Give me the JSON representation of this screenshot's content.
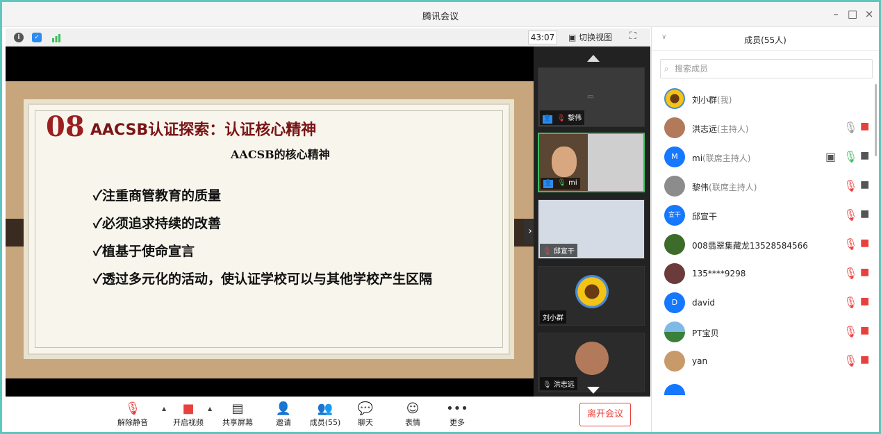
{
  "window": {
    "title": "腾讯会议"
  },
  "infobar": {
    "timer": "43:07",
    "switch_view": "切换视图"
  },
  "slide": {
    "number": "08",
    "title": "AACSB认证探索：认证核心精神",
    "subtitle": "AACSB的核心精神",
    "bullets": [
      "✓注重商管教育的质量",
      "✓必须追求持续的改善",
      "✓植基于使命宣言",
      "✓透过多元化的活动，使认证学校可以与其他学校产生区隔"
    ]
  },
  "thumbnails": [
    {
      "name": "黎伟"
    },
    {
      "name": "mi"
    },
    {
      "name": "邱宣干"
    },
    {
      "name": "刘小群"
    },
    {
      "name": "洪志远"
    }
  ],
  "toolbar": {
    "unmute": "解除静音",
    "start_video": "开启视频",
    "share_screen": "共享屏幕",
    "invite": "邀请",
    "members": "成员(55)",
    "chat": "聊天",
    "reactions": "表情",
    "more": "更多",
    "leave": "离开会议"
  },
  "members": {
    "title": "成员(55人)",
    "search_placeholder": "搜索成员",
    "list": [
      {
        "name": "刘小群",
        "role": "(我)"
      },
      {
        "name": "洪志远",
        "role": "(主持人)"
      },
      {
        "name": "mi",
        "role": "(联席主持人)",
        "avatar_text": "M"
      },
      {
        "name": "黎伟",
        "role": "(联席主持人)"
      },
      {
        "name": "邱宣干",
        "role": "",
        "avatar_text": "宣干"
      },
      {
        "name": "008翡翠集藏龙13528584566",
        "role": ""
      },
      {
        "name": "135****9298",
        "role": ""
      },
      {
        "name": "david",
        "role": "",
        "avatar_text": "D"
      },
      {
        "name": "PT宝贝",
        "role": ""
      },
      {
        "name": "yan",
        "role": ""
      }
    ]
  },
  "colors": {
    "accent": "#2d8cf0",
    "danger": "#e8413d",
    "active_border": "#3bbf5a"
  }
}
